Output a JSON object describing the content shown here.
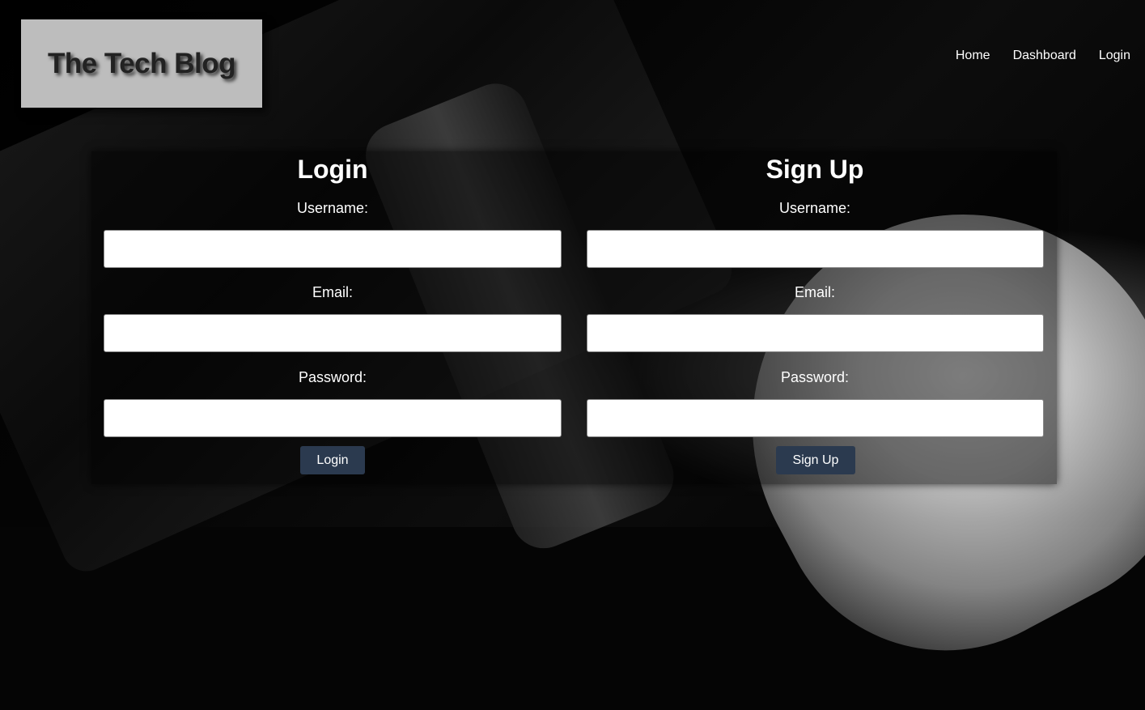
{
  "header": {
    "logo_text": "The Tech Blog",
    "nav": [
      {
        "label": "Home"
      },
      {
        "label": "Dashboard"
      },
      {
        "label": "Login"
      }
    ]
  },
  "login_form": {
    "title": "Login",
    "username_label": "Username:",
    "username_value": "",
    "email_label": "Email:",
    "email_value": "",
    "password_label": "Password:",
    "password_value": "",
    "submit_label": "Login"
  },
  "signup_form": {
    "title": "Sign Up",
    "username_label": "Username:",
    "username_value": "",
    "email_label": "Email:",
    "email_value": "",
    "password_label": "Password:",
    "password_value": "",
    "submit_label": "Sign Up"
  },
  "colors": {
    "button_bg": "#2b3a4f",
    "logo_bg": "#bdbdbd"
  }
}
